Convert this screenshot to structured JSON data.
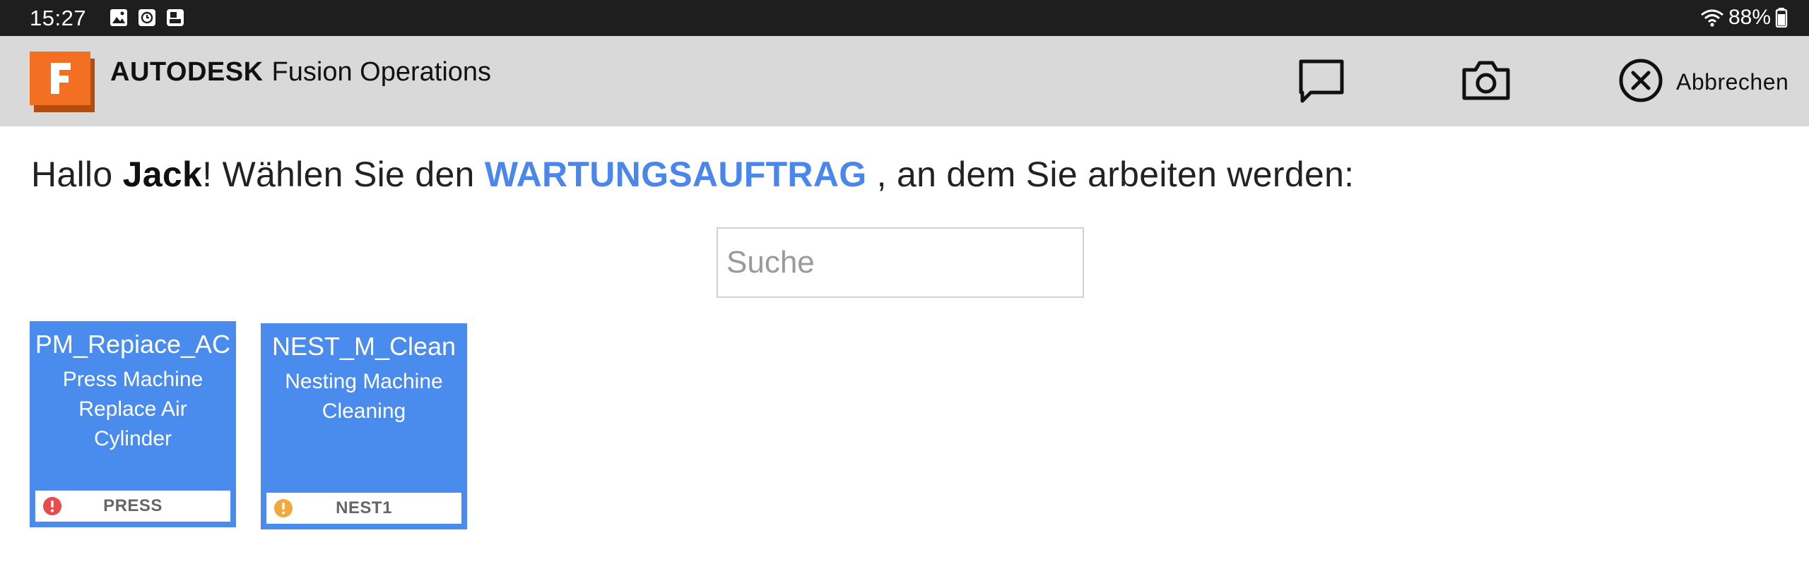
{
  "status_bar": {
    "time": "15:27",
    "notification_icons": [
      "image-icon",
      "clock-icon",
      "screenshot-icon"
    ],
    "battery": "88%"
  },
  "app_bar": {
    "logo_letter": "F",
    "brand_primary": "AUTODESK",
    "brand_secondary": "Fusion Operations",
    "actions": {
      "message_icon": "chat-bubble-icon",
      "camera_icon": "camera-icon",
      "cancel_label": "Abbrechen"
    }
  },
  "greeting": {
    "hello": "Hallo ",
    "user": "Jack",
    "middle": "! Wählen Sie den ",
    "keyword": "WARTUNGSAUFTRAG",
    "suffix": " , an dem Sie arbeiten werden:"
  },
  "search": {
    "placeholder": "Suche",
    "value": ""
  },
  "cards": [
    {
      "code": "PM_Repiace_AC",
      "description": "Press Machine Replace Air Cylinder",
      "station": "PRESS",
      "priority": "high",
      "priority_color": "#e84c4c"
    },
    {
      "code": "NEST_M_Clean",
      "description": "Nesting Machine Cleaning",
      "station": "NEST1",
      "priority": "medium",
      "priority_color": "#f2a93b"
    }
  ],
  "colors": {
    "status_bar": "#1e1e1e",
    "app_bar": "#d9d9d9",
    "accent": "#4a86ec",
    "card": "#4a8bee",
    "logo_orange": "#f37022"
  }
}
